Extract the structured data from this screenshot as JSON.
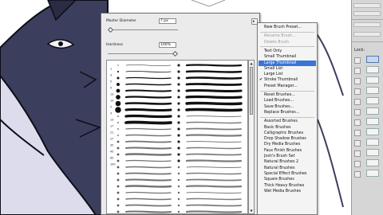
{
  "brush_picker": {
    "master_diameter_label": "Master Diameter",
    "master_diameter_value": "7 px",
    "hardness_label": "Hardness",
    "hardness_value": "100%",
    "flyout_button": "▸",
    "brush_sizes": [
      "1",
      "3",
      "5",
      "9",
      "13",
      "19",
      "5",
      "9",
      "13",
      "17",
      "21",
      "27",
      "35",
      "45",
      "65",
      "100"
    ]
  },
  "flyout_menu": {
    "items": [
      {
        "label": "New Brush Preset...",
        "disabled": false
      },
      {
        "sep": true
      },
      {
        "label": "Rename Brush...",
        "disabled": true
      },
      {
        "label": "Delete Brush",
        "disabled": true
      },
      {
        "sep": true
      },
      {
        "label": "Text Only",
        "disabled": false
      },
      {
        "label": "Small Thumbnail",
        "disabled": false
      },
      {
        "label": "Large Thumbnail",
        "disabled": false,
        "highlight": true
      },
      {
        "label": "Small List",
        "disabled": false
      },
      {
        "label": "Large List",
        "disabled": false
      },
      {
        "label": "Stroke Thumbnail",
        "disabled": false,
        "checked": true,
        "check": "✔"
      },
      {
        "label": "Preset Manager...",
        "disabled": false
      },
      {
        "sep": true
      },
      {
        "label": "Reset Brushes...",
        "disabled": false
      },
      {
        "label": "Load Brushes...",
        "disabled": false
      },
      {
        "label": "Save Brushes...",
        "disabled": false
      },
      {
        "label": "Replace Brushes...",
        "disabled": false
      },
      {
        "sep": true
      },
      {
        "label": "Assorted Brushes",
        "disabled": false
      },
      {
        "label": "Basic Brushes",
        "disabled": false
      },
      {
        "label": "Calligraphic Brushes",
        "disabled": false
      },
      {
        "label": "Drop Shadow Brushes",
        "disabled": false
      },
      {
        "label": "Dry Media Brushes",
        "disabled": false
      },
      {
        "label": "Faux Finish Brushes",
        "disabled": false
      },
      {
        "label": "Josh's Brush Set",
        "disabled": false
      },
      {
        "label": "Natural Brushes 2",
        "disabled": false
      },
      {
        "label": "Natural Brushes",
        "disabled": false
      },
      {
        "label": "Special Effect Brushes",
        "disabled": false
      },
      {
        "label": "Square Brushes",
        "disabled": false
      },
      {
        "label": "Thick Heavy Brushes",
        "disabled": false
      },
      {
        "label": "Wet Media Brushes",
        "disabled": false
      }
    ]
  },
  "right_dock": {
    "labels": [
      "Lock:"
    ]
  },
  "colors": {
    "menu_highlight": "#3875d7",
    "wolf_fur": "#3c3e5e",
    "wolf_fur_light": "#dcdcec",
    "panel_bg": "#ebebeb"
  }
}
